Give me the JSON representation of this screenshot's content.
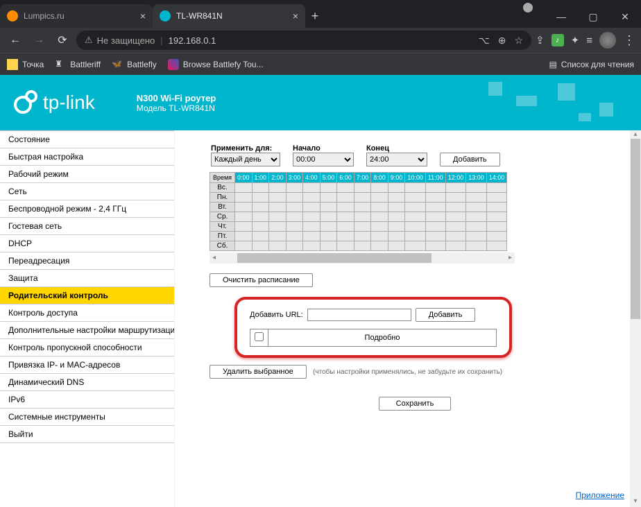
{
  "browser": {
    "tabs": [
      {
        "title": "Lumpics.ru",
        "favicon": "#ff8c00"
      },
      {
        "title": "TL-WR841N",
        "favicon": "#00b5cc"
      }
    ],
    "url_warning": "Не защищено",
    "url": "192.168.0.1",
    "bookmarks": [
      "Точка",
      "Battleriff",
      "Battlefly",
      "Browse Battlefy Tou..."
    ],
    "reading_list": "Список для чтения"
  },
  "header": {
    "brand": "tp-link",
    "product": "N300 Wi-Fi роутер",
    "model": "Модель TL-WR841N"
  },
  "nav": [
    "Состояние",
    "Быстрая настройка",
    "Рабочий режим",
    "Сеть",
    "Беспроводной режим - 2,4 ГГц",
    "Гостевая сеть",
    "DHCP",
    "Переадресация",
    "Защита",
    "Родительский контроль",
    "Контроль доступа",
    "Дополнительные настройки маршрутизации",
    "Контроль пропускной способности",
    "Привязка IP- и MAC-адресов",
    "Динамический DNS",
    "IPv6",
    "Системные инструменты",
    "Выйти"
  ],
  "nav_active": 9,
  "schedule": {
    "apply_for_label": "Применить для:",
    "apply_for_value": "Каждый день",
    "start_label": "Начало",
    "start_value": "00:00",
    "end_label": "Конец",
    "end_value": "24:00",
    "add_btn": "Добавить",
    "time_label": "Время",
    "hours": [
      "0:00",
      "1:00",
      "2:00",
      "3:00",
      "4:00",
      "5:00",
      "6:00",
      "7:00",
      "8:00",
      "9:00",
      "10:00",
      "11:00",
      "12:00",
      "13:00",
      "14:00"
    ],
    "days": [
      "Вс.",
      "Пн.",
      "Вт.",
      "Ср.",
      "Чт.",
      "Пт.",
      "Сб."
    ],
    "clear_btn": "Очистить расписание"
  },
  "url_block": {
    "add_label": "Добавить URL:",
    "add_btn": "Добавить",
    "detail_header": "Подробно"
  },
  "actions": {
    "delete_selected": "Удалить выбранное",
    "note": "(чтобы настройки применялись, не забудьте их сохранить)",
    "save": "Сохранить",
    "app_link": "Приложение"
  }
}
